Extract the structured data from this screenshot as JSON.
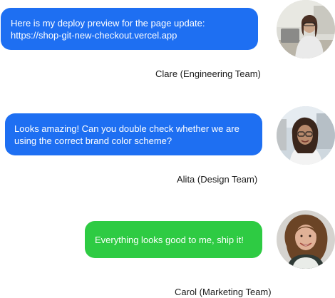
{
  "messages": [
    {
      "text": "Here is my deploy preview for the page update:\nhttps://shop-git-new-checkout.vercel.app",
      "author": "Clare (Engineering Team)",
      "bubble_color": "#1e6ff2",
      "avatar": "woman-at-laptop-photo"
    },
    {
      "text": "Looks amazing! Can you double check whether we are\nusing the correct brand color scheme?",
      "author": "Alita (Design Team)",
      "bubble_color": "#1e6ff2",
      "avatar": "woman-with-glasses-photo"
    },
    {
      "text": "Everything looks good to me, ship it!",
      "author": "Carol (Marketing Team)",
      "bubble_color": "#2ecb43",
      "avatar": "smiling-woman-curly-hair-photo"
    }
  ]
}
